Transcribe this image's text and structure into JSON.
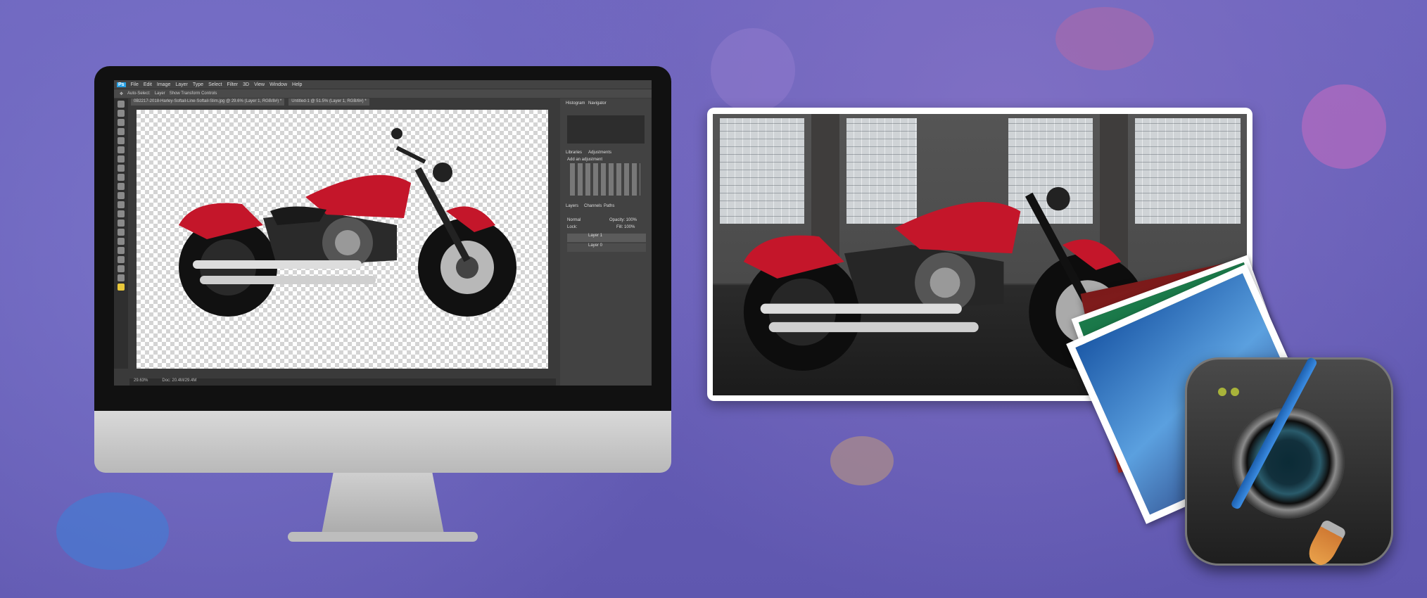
{
  "photoshop": {
    "menu": [
      "Ps",
      "File",
      "Edit",
      "Image",
      "Layer",
      "Type",
      "Select",
      "Filter",
      "3D",
      "View",
      "Window",
      "Help"
    ],
    "options": [
      "Auto-Select:",
      "Layer",
      "Show Transform Controls"
    ],
    "doc_tabs": [
      "0B2217-2018-Harley-Softail-Line-Softail-Slim.jpg @ 29.6% (Layer 1, RGB/8#) *",
      "Untitled-1 @ 51.5% (Layer 1, RGB/8#) *"
    ],
    "panels": {
      "top_tabs": [
        "Histogram",
        "Navigator"
      ],
      "mid_tabs": [
        "Libraries",
        "Adjustments"
      ],
      "adj_title": "Add an adjustment",
      "layer_tabs": [
        "Layers",
        "Channels",
        "Paths"
      ],
      "blend": "Normal",
      "opacity": "Opacity: 100%",
      "lock": "Lock:",
      "fill": "Fill: 100%",
      "layers": [
        "Layer 1",
        "Layer 0"
      ]
    },
    "status": [
      "29.63%",
      "Doc: 20.4M/29.4M"
    ]
  },
  "colors": {
    "background": "#6a5fb5",
    "accent_red": "#c4162a"
  }
}
